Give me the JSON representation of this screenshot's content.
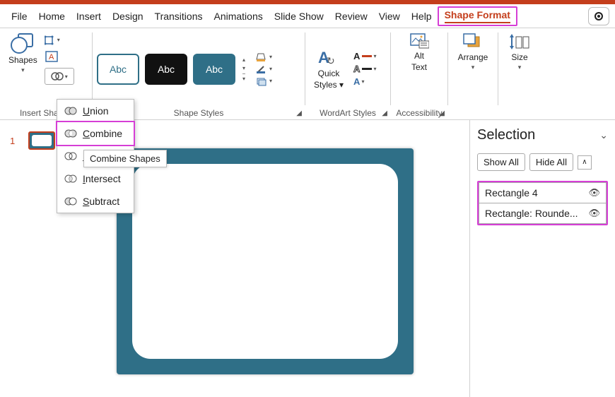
{
  "menubar": {
    "items": [
      "File",
      "Home",
      "Insert",
      "Design",
      "Transitions",
      "Animations",
      "Slide Show",
      "Review",
      "View",
      "Help",
      "Shape Format"
    ],
    "active_index": 10
  },
  "ribbon": {
    "insert_shapes": {
      "shapes_label": "Shapes",
      "group_label": "Insert Shapes"
    },
    "shape_styles": {
      "group_label": "Shape Styles",
      "swatch_text": "Abc"
    },
    "quick_styles_label": "Quick Styles",
    "wordart_label": "WordArt Styles",
    "alt_text_label": "Alt Text",
    "alt_text_btn_line1": "Alt",
    "alt_text_btn_line2": "Text",
    "accessibility_label": "Accessibility",
    "arrange_label": "Arrange",
    "size_label": "Size"
  },
  "merge_menu": {
    "items": [
      {
        "label": "Union",
        "underline": "U",
        "rest": "nion"
      },
      {
        "label": "Combine",
        "underline": "C",
        "rest": "ombine"
      },
      {
        "label": "Fragment",
        "underline": "F",
        "rest": "ragment"
      },
      {
        "label": "Intersect",
        "underline": "I",
        "rest": "ntersect"
      },
      {
        "label": "Subtract",
        "underline": "S",
        "rest": "ubtract"
      }
    ],
    "selected_index": 1,
    "tooltip": "Combine Shapes"
  },
  "thumbnail": {
    "number": "1"
  },
  "selection_pane": {
    "title": "Selection",
    "show_all": "Show All",
    "hide_all": "Hide All",
    "items": [
      "Rectangle 4",
      "Rectangle: Rounde..."
    ]
  }
}
